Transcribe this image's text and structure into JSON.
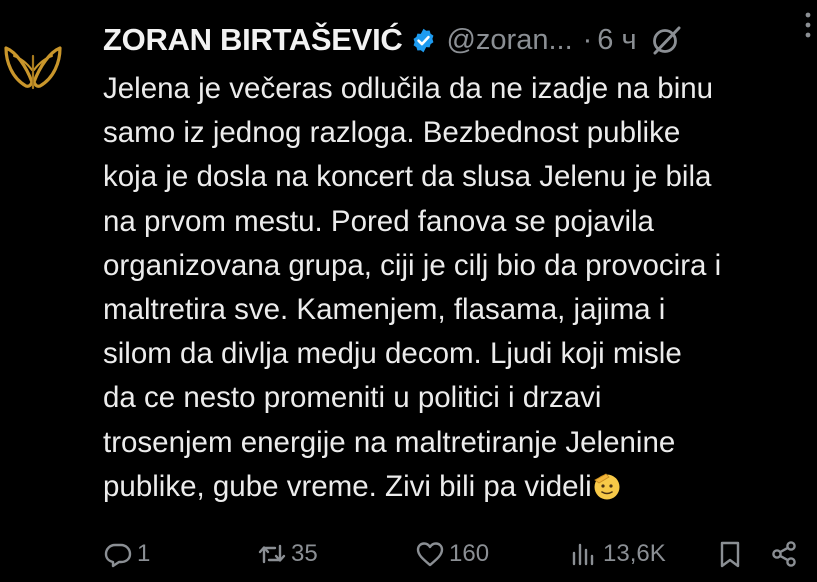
{
  "author": {
    "display_name": "ZORAN BIRTAŠEVIĆ",
    "handle": "@zoran...",
    "separator": "·",
    "time": "6 ч"
  },
  "tweet": {
    "lines": [
      "Jelena je večeras odlučila da ne izadje  na binu",
      "samo iz jednog razloga. Bezbednost publike",
      "koja je dosla na koncert da slusa Jelenu je bila",
      "na prvom mestu. Pored fanova se pojavila",
      "organizovana grupa, ciji je cilj bio da provocira i",
      "maltretira sve. Kamenjem, flasama, jajima i",
      "silom da divlja medju decom. Ljudi koji misle",
      "da ce nesto promeniti u politici i drzavi",
      "trosenjem energije na maltretiranje Jelenine",
      "publike, gube vreme. Zivi bili pa videli"
    ]
  },
  "actions": {
    "replies": "1",
    "reposts": "35",
    "likes": "160",
    "views": "13,6K"
  },
  "icons": {
    "avatar": "gold-butterfly-logo",
    "verified": "verified-badge-icon",
    "grok": "grok-icon",
    "more": "more-options-icon",
    "emoji": "saluting-face-emoji",
    "reply": "reply-icon",
    "repost": "repost-icon",
    "like": "heart-icon",
    "views": "views-icon",
    "bookmark": "bookmark-icon",
    "share": "share-icon"
  },
  "colors": {
    "background": "#000000",
    "text": "#e7e9ea",
    "muted": "#8b8f94",
    "verified": "#1d9bf0",
    "avatar_gold": "#c9962b"
  }
}
